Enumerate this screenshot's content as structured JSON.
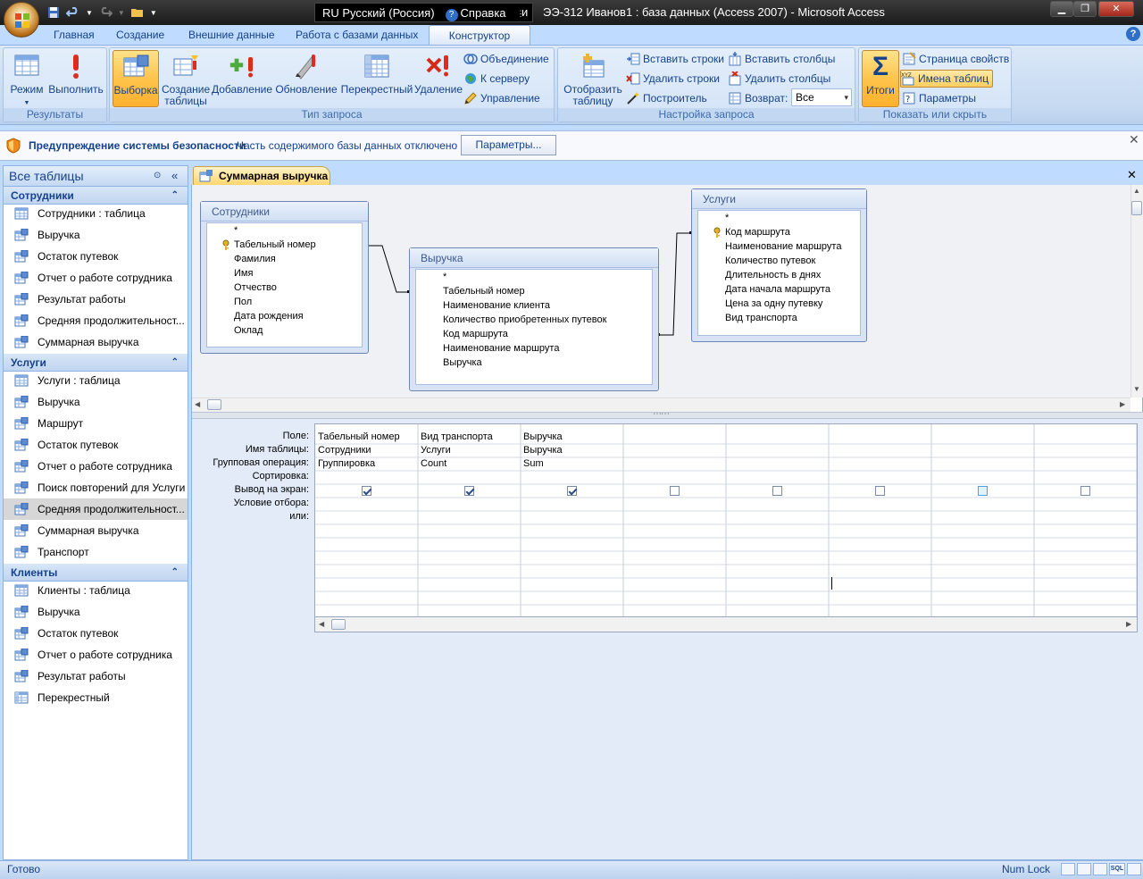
{
  "window": {
    "title": "ЭЭ-312 Иванов1 : база данных (Access 2007) - Microsoft Access",
    "language_indicator": "RU Русский (Россия)",
    "help_label": "Справка",
    "title_prefix_char": "и"
  },
  "ribbon": {
    "tabs": [
      {
        "label": "Главная"
      },
      {
        "label": "Создание"
      },
      {
        "label": "Внешние данные"
      },
      {
        "label": "Работа с базами данных"
      },
      {
        "label": "Конструктор"
      }
    ],
    "active_tab": "Конструктор",
    "groups": {
      "results": {
        "label": "Результаты",
        "mode": "Режим",
        "run": "Выполнить"
      },
      "query_type": {
        "label": "Тип запроса",
        "select": "Выборка",
        "make_table": "Создание таблицы",
        "append": "Добавление",
        "update": "Обновление",
        "crosstab": "Перекрестный",
        "delete": "Удаление",
        "union": "Объединение",
        "pass_through": "К серверу",
        "data_definition": "Управление"
      },
      "query_setup": {
        "label": "Настройка запроса",
        "show_table": "Отобразить таблицу",
        "insert_rows": "Вставить строки",
        "delete_rows": "Удалить строки",
        "builder": "Построитель",
        "insert_columns": "Вставить столбцы",
        "delete_columns": "Удалить столбцы",
        "return_label": "Возврат:",
        "return_value": "Все"
      },
      "show_hide": {
        "label": "Показать или скрыть",
        "totals": "Итоги",
        "property_sheet": "Страница свойств",
        "table_names": "Имена таблиц",
        "parameters": "Параметры"
      }
    }
  },
  "security_bar": {
    "title": "Предупреждение системы безопасности",
    "message": "Часть содержимого базы данных отключено",
    "button": "Параметры..."
  },
  "nav": {
    "header": "Все таблицы",
    "groups": [
      {
        "name": "Сотрудники",
        "items": [
          {
            "label": "Сотрудники : таблица",
            "type": "table"
          },
          {
            "label": "Выручка",
            "type": "query"
          },
          {
            "label": "Остаток путевок",
            "type": "query"
          },
          {
            "label": "Отчет о работе сотрудника",
            "type": "query"
          },
          {
            "label": "Результат работы",
            "type": "query"
          },
          {
            "label": "Средняя продолжительност...",
            "type": "query"
          },
          {
            "label": "Суммарная выручка",
            "type": "query"
          }
        ]
      },
      {
        "name": "Услуги",
        "items": [
          {
            "label": "Услуги : таблица",
            "type": "table"
          },
          {
            "label": "Выручка",
            "type": "query"
          },
          {
            "label": "Маршрут",
            "type": "query"
          },
          {
            "label": "Остаток путевок",
            "type": "query"
          },
          {
            "label": "Отчет о работе сотрудника",
            "type": "query"
          },
          {
            "label": "Поиск повторений для Услуги",
            "type": "query"
          },
          {
            "label": "Средняя продолжительност...",
            "type": "query"
          },
          {
            "label": "Суммарная выручка",
            "type": "query"
          },
          {
            "label": "Транспорт",
            "type": "query"
          }
        ]
      },
      {
        "name": "Клиенты",
        "items": [
          {
            "label": "Клиенты : таблица",
            "type": "table"
          },
          {
            "label": "Выручка",
            "type": "query"
          },
          {
            "label": "Остаток путевок",
            "type": "query"
          },
          {
            "label": "Отчет о работе сотрудника",
            "type": "query"
          },
          {
            "label": "Результат работы",
            "type": "query"
          },
          {
            "label": "Перекрестный",
            "type": "crosstab"
          }
        ]
      }
    ]
  },
  "document": {
    "tab_label": "Суммарная выручка",
    "tables": [
      {
        "name": "Сотрудники",
        "fields": [
          "*",
          "Табельный номер",
          "Фамилия",
          "Имя",
          "Отчество",
          "Пол",
          "Дата рождения",
          "Оклад"
        ],
        "key_index": 1
      },
      {
        "name": "Выручка",
        "fields": [
          "*",
          "Табельный номер",
          "Наименование клиента",
          "Количество приобретенных путевок",
          "Код маршрута",
          "Наименование маршрута",
          "Выручка"
        ],
        "key_index": -1
      },
      {
        "name": "Услуги",
        "fields": [
          "*",
          "Код маршрута",
          "Наименование маршрута",
          "Количество путевок",
          "Длительность в днях",
          "Дата начала маршрута",
          "Цена за одну путевку",
          "Вид транспорта"
        ],
        "key_index": 1
      }
    ],
    "grid": {
      "row_labels": [
        "Поле:",
        "Имя таблицы:",
        "Групповая операция:",
        "Сортировка:",
        "Вывод на экран:",
        "Условие отбора:",
        "или:"
      ],
      "columns": [
        {
          "field": "Табельный номер",
          "table": "Сотрудники",
          "total": "Группировка",
          "show": true
        },
        {
          "field": "Вид транспорта",
          "table": "Услуги",
          "total": "Count",
          "show": true
        },
        {
          "field": "Выручка",
          "table": "Выручка",
          "total": "Sum",
          "show": true
        },
        {
          "field": "",
          "table": "",
          "total": "",
          "show": false
        },
        {
          "field": "",
          "table": "",
          "total": "",
          "show": false
        },
        {
          "field": "",
          "table": "",
          "total": "",
          "show": false
        },
        {
          "field": "",
          "table": "",
          "total": "",
          "show": false,
          "highlight": true
        },
        {
          "field": "",
          "table": "",
          "total": "",
          "show": false
        }
      ]
    }
  },
  "status": {
    "text": "Готово",
    "numlock": "Num Lock"
  }
}
